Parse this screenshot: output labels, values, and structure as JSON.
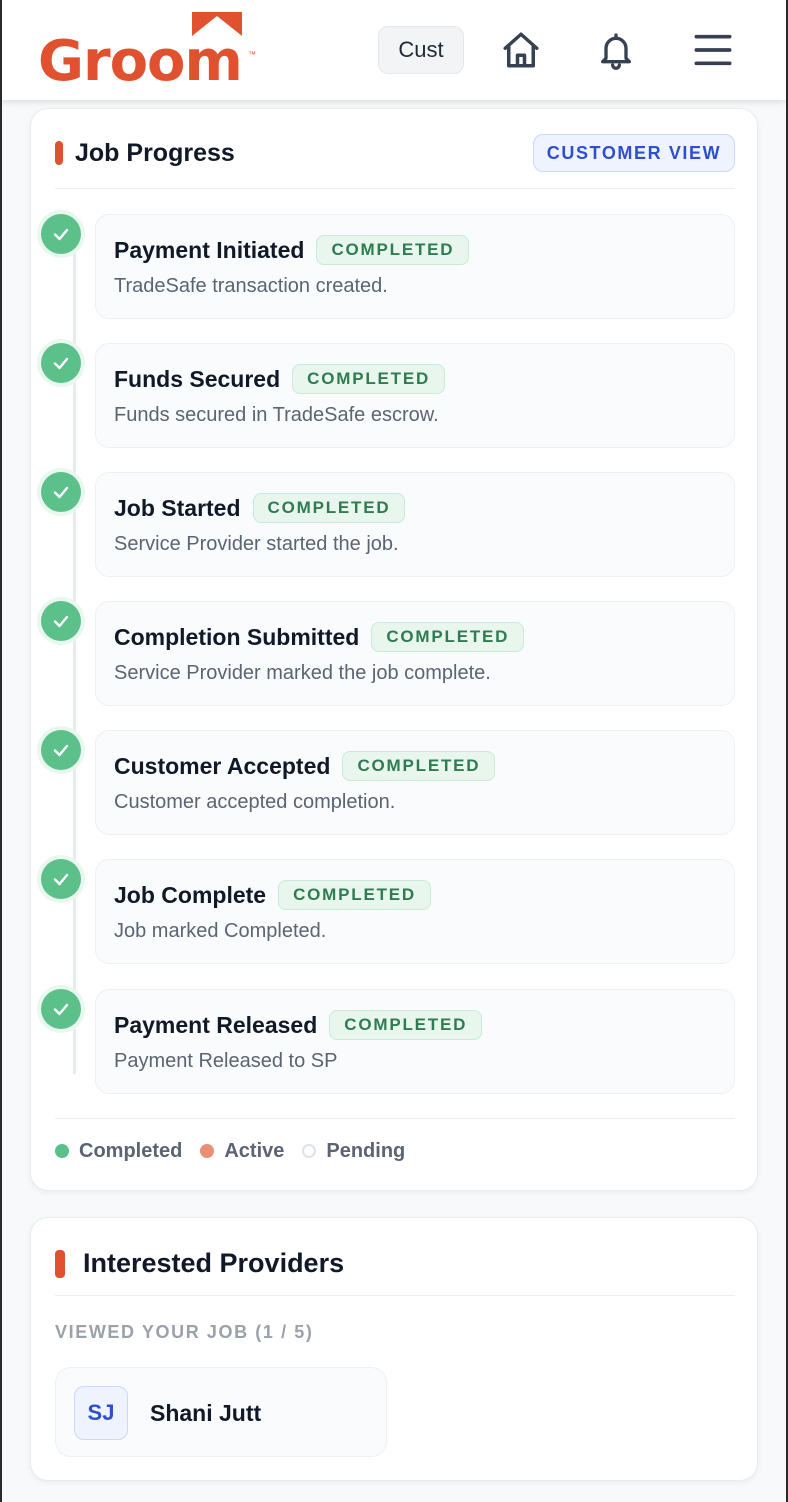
{
  "brand": {
    "name": "Groom",
    "trademark": "™",
    "accent_color": "#e0522f"
  },
  "header": {
    "role_chip": "Cust",
    "icons": [
      "home-icon",
      "bell-icon",
      "menu-icon"
    ]
  },
  "job_progress": {
    "title": "Job Progress",
    "view_badge": "CUSTOMER VIEW",
    "steps": [
      {
        "title": "Payment Initiated",
        "status": "COMPLETED",
        "description": "TradeSafe transaction created."
      },
      {
        "title": "Funds Secured",
        "status": "COMPLETED",
        "description": "Funds secured in TradeSafe escrow."
      },
      {
        "title": "Job Started",
        "status": "COMPLETED",
        "description": "Service Provider started the job."
      },
      {
        "title": "Completion Submitted",
        "status": "COMPLETED",
        "description": "Service Provider marked the job complete."
      },
      {
        "title": "Customer Accepted",
        "status": "COMPLETED",
        "description": "Customer accepted completion."
      },
      {
        "title": "Job Complete",
        "status": "COMPLETED",
        "description": "Job marked Completed."
      },
      {
        "title": "Payment Released",
        "status": "COMPLETED",
        "description": "Payment Released to SP"
      }
    ],
    "legend": [
      {
        "label": "Completed",
        "color": "#5bc08a"
      },
      {
        "label": "Active",
        "color": "#eb8e78"
      },
      {
        "label": "Pending",
        "color": "#ffffff"
      }
    ],
    "status_colors": {
      "completed_text": "#2f7b52",
      "completed_bg": "#e8f6ee"
    }
  },
  "interested_providers": {
    "title": "Interested Providers",
    "viewed_label": "VIEWED YOUR JOB (1 / 5)",
    "providers": [
      {
        "initials": "SJ",
        "name": "Shani Jutt"
      }
    ]
  }
}
